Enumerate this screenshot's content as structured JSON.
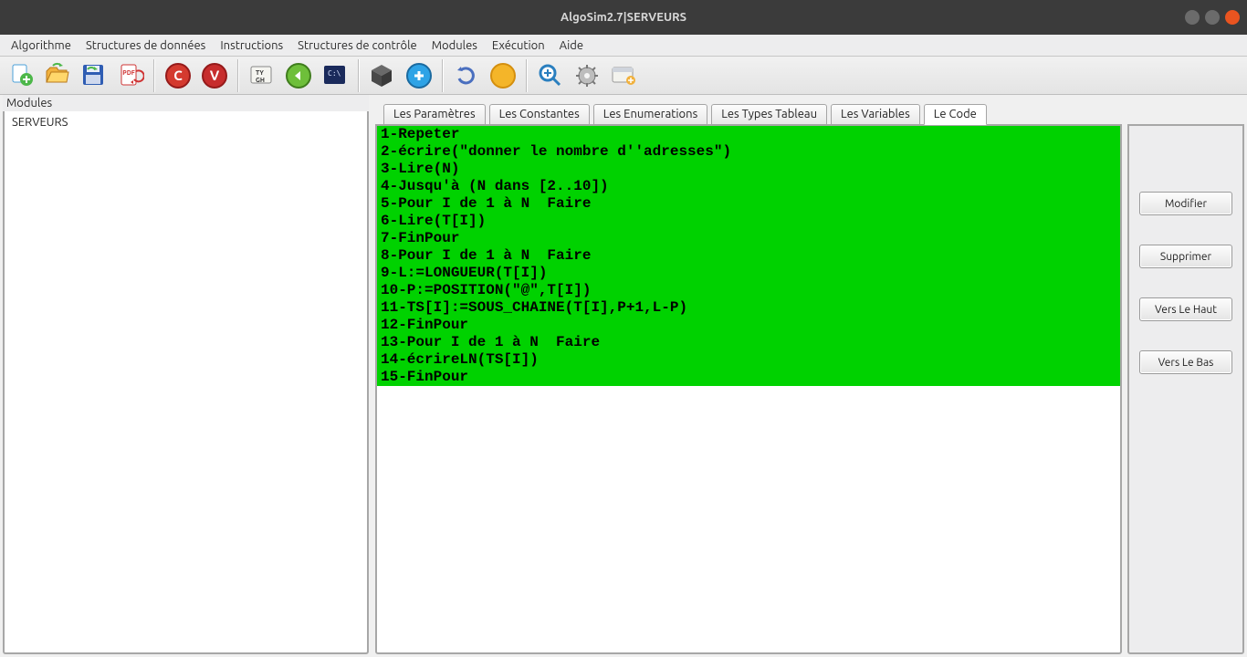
{
  "title": "AlgoSim2.7|SERVEURS",
  "menubar": [
    "Algorithme",
    "Structures de données",
    "Instructions",
    "Structures de contrôle",
    "Modules",
    "Exécution",
    "Aide"
  ],
  "toolbar_icons": [
    {
      "name": "new-file-icon"
    },
    {
      "name": "open-folder-icon"
    },
    {
      "name": "save-floppy-icon"
    },
    {
      "name": "export-pdf-icon"
    },
    {
      "sep": true
    },
    {
      "name": "red-c-icon",
      "letter": "C",
      "bg": "#d43a2f"
    },
    {
      "name": "red-v-icon",
      "letter": "V",
      "bg": "#c72d2d"
    },
    {
      "sep": true
    },
    {
      "name": "type-panel-icon"
    },
    {
      "name": "back-arrow-icon"
    },
    {
      "name": "terminal-icon"
    },
    {
      "sep": true
    },
    {
      "name": "cube-icon"
    },
    {
      "name": "blue-plus-icon"
    },
    {
      "sep": true
    },
    {
      "name": "refresh-icon"
    },
    {
      "name": "yellow-dot-icon"
    },
    {
      "sep": true
    },
    {
      "name": "zoom-icon"
    },
    {
      "name": "gear-icon"
    },
    {
      "name": "window-icon"
    }
  ],
  "sidebar": {
    "title": "Modules",
    "items": [
      "SERVEURS"
    ]
  },
  "tabs": [
    "Les Paramètres",
    "Les Constantes",
    "Les Enumerations",
    "Les Types Tableau",
    "Les Variables",
    "Le Code"
  ],
  "active_tab": "Le Code",
  "code_lines": [
    "1-Repeter",
    "2-écrire(\"donner le nombre d''adresses\")",
    "3-Lire(N)",
    "4-Jusqu'à (N dans [2..10])",
    "5-Pour I de 1 à N  Faire",
    "6-Lire(T[I])",
    "7-FinPour",
    "8-Pour I de 1 à N  Faire",
    "9-L:=LONGUEUR(T[I])",
    "10-P:=POSITION(\"@\",T[I])",
    "11-TS[I]:=SOUS_CHAINE(T[I],P+1,L-P)",
    "12-FinPour",
    "13-Pour I de 1 à N  Faire",
    "14-écrireLN(TS[I])",
    "15-FinPour"
  ],
  "side_buttons": [
    "Modifier",
    "Supprimer",
    "Vers Le Haut",
    "Vers Le Bas"
  ]
}
